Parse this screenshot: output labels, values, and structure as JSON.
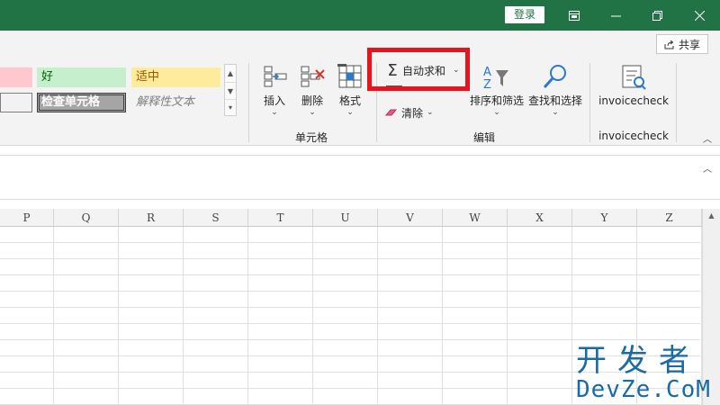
{
  "titlebar": {
    "login_label": "登录",
    "accent": "#217346"
  },
  "ribbon": {
    "share_label": "共享",
    "styles": {
      "good": "好",
      "neutral": "适中",
      "check_cell": "检查单元格",
      "explanatory": "解释性文本"
    },
    "cells_group": {
      "label": "单元格",
      "insert": "插入",
      "delete": "删除",
      "format": "格式"
    },
    "editing_group": {
      "label": "编辑",
      "autosum": "自动求和",
      "clear": "清除",
      "sort_filter": "排序和筛选",
      "find_select": "查找和选择"
    },
    "addin_group": {
      "label": "invoicecheck",
      "button": "invoicecheck"
    }
  },
  "sheet": {
    "columns": [
      "P",
      "Q",
      "R",
      "S",
      "T",
      "U",
      "V",
      "W",
      "X",
      "Y",
      "Z"
    ]
  },
  "watermark": {
    "line1": "开发者",
    "line2": "DevZe.CoM"
  }
}
